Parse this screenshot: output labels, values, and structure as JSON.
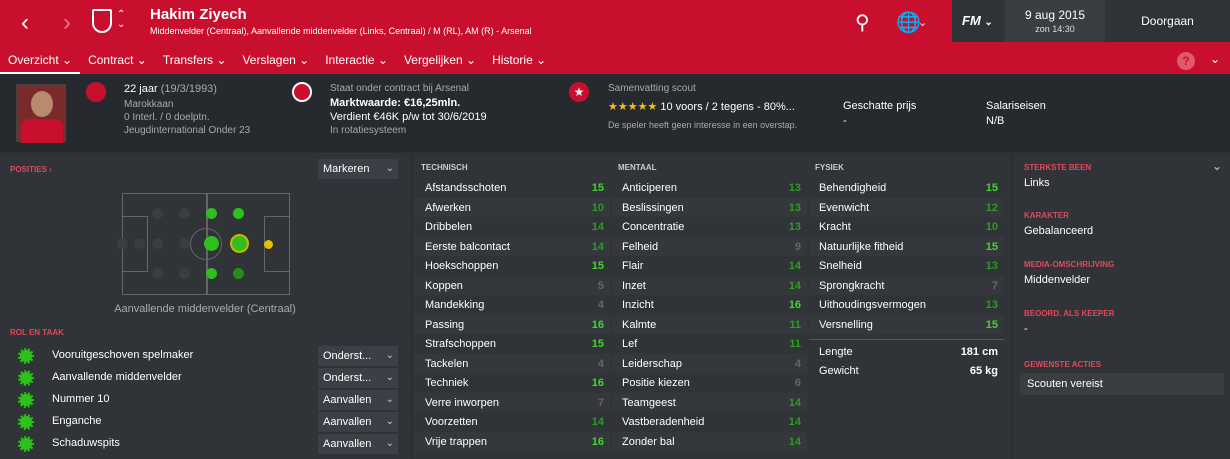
{
  "top": {
    "player_name": "Hakim Ziyech",
    "player_subtitle": "Middenvelder (Centraal), Aanvallende middenvelder (Links, Centraal) / M (RL), AM (R) - Arsenal",
    "date": "9 aug 2015",
    "time": "zon 14:30",
    "continue_label": "Doorgaan",
    "fm_label": "FM"
  },
  "tabs": [
    {
      "label": "Overzicht",
      "active": true
    },
    {
      "label": "Contract"
    },
    {
      "label": "Transfers"
    },
    {
      "label": "Verslagen"
    },
    {
      "label": "Interactie"
    },
    {
      "label": "Vergelijken"
    },
    {
      "label": "Historie"
    }
  ],
  "header": {
    "age": "22 jaar",
    "dob": "(19/3/1993)",
    "nationality": "Marokkaan",
    "caps": "0 Interl. / 0 doelptn.",
    "youth": "Jeugdinternational Onder 23",
    "contract_status": "Staat onder contract bij Arsenal",
    "value": "Marktwaarde: €16,25mln.",
    "wage": "Verdient €46K p/w tot 30/6/2019",
    "squad_status": "In rotatiesysteem",
    "scout_title": "Samenvatting scout",
    "scout_stars": "★★★★★",
    "scout_summary": "10 voors / 2 tegens - 80%...",
    "scout_note": "De speler heeft geen interesse in een overstap.",
    "est_price_label": "Geschatte prijs",
    "est_price_value": "-",
    "wage_demand_label": "Salariseisen",
    "wage_demand_value": "N/B"
  },
  "positions": {
    "label": "POSITIES",
    "dropdown": "Markeren",
    "position_text": "Aanvallende middenvelder (Centraal)"
  },
  "roles": {
    "label": "ROL EN TAAK",
    "items": [
      {
        "name": "Vooruitgeschoven spelmaker",
        "duty": "Onderst..."
      },
      {
        "name": "Aanvallende middenvelder",
        "duty": "Onderst..."
      },
      {
        "name": "Nummer 10",
        "duty": "Aanvallen"
      },
      {
        "name": "Enganche",
        "duty": "Aanvallen"
      },
      {
        "name": "Schaduwspits",
        "duty": "Aanvallen"
      }
    ]
  },
  "technical": {
    "label": "TECHNISCH",
    "items": [
      {
        "name": "Afstandsschoten",
        "value": "15"
      },
      {
        "name": "Afwerken",
        "value": "10"
      },
      {
        "name": "Dribbelen",
        "value": "14"
      },
      {
        "name": "Eerste balcontact",
        "value": "14"
      },
      {
        "name": "Hoekschoppen",
        "value": "15"
      },
      {
        "name": "Koppen",
        "value": "5"
      },
      {
        "name": "Mandekking",
        "value": "4"
      },
      {
        "name": "Passing",
        "value": "16"
      },
      {
        "name": "Strafschoppen",
        "value": "15"
      },
      {
        "name": "Tackelen",
        "value": "4"
      },
      {
        "name": "Techniek",
        "value": "16"
      },
      {
        "name": "Verre inworpen",
        "value": "7"
      },
      {
        "name": "Voorzetten",
        "value": "14"
      },
      {
        "name": "Vrije trappen",
        "value": "16"
      }
    ]
  },
  "mental": {
    "label": "MENTAAL",
    "items": [
      {
        "name": "Anticiperen",
        "value": "13"
      },
      {
        "name": "Beslissingen",
        "value": "13"
      },
      {
        "name": "Concentratie",
        "value": "13"
      },
      {
        "name": "Felheid",
        "value": "9"
      },
      {
        "name": "Flair",
        "value": "14"
      },
      {
        "name": "Inzet",
        "value": "14"
      },
      {
        "name": "Inzicht",
        "value": "16"
      },
      {
        "name": "Kalmte",
        "value": "11"
      },
      {
        "name": "Lef",
        "value": "11"
      },
      {
        "name": "Leiderschap",
        "value": "4"
      },
      {
        "name": "Positie kiezen",
        "value": "6"
      },
      {
        "name": "Teamgeest",
        "value": "14"
      },
      {
        "name": "Vastberadenheid",
        "value": "14"
      },
      {
        "name": "Zonder bal",
        "value": "14"
      }
    ]
  },
  "physical": {
    "label": "FYSIEK",
    "items": [
      {
        "name": "Behendigheid",
        "value": "15"
      },
      {
        "name": "Evenwicht",
        "value": "12"
      },
      {
        "name": "Kracht",
        "value": "10"
      },
      {
        "name": "Natuurlijke fitheid",
        "value": "15"
      },
      {
        "name": "Snelheid",
        "value": "13"
      },
      {
        "name": "Sprongkracht",
        "value": "7"
      },
      {
        "name": "Uithoudingsvermogen",
        "value": "13"
      },
      {
        "name": "Versnelling",
        "value": "15"
      }
    ],
    "height_label": "Lengte",
    "height_value": "181 cm",
    "weight_label": "Gewicht",
    "weight_value": "65 kg"
  },
  "side": {
    "foot_label": "STERKSTE BEEN",
    "foot_value": "Links",
    "character_label": "KARAKTER",
    "character_value": "Gebalanceerd",
    "media_label": "MEDIA-OMSCHRIJVING",
    "media_value": "Middenvelder",
    "keeper_label": "BEOORD. ALS KEEPER",
    "keeper_value": "-",
    "actions_label": "GEWENSTE ACTIES",
    "actions_value": "Scouten vereist"
  },
  "colors": {
    "brand": "#c8102e",
    "high": "#3fd62f",
    "mid": "#2e9b22",
    "low": "#666666"
  }
}
